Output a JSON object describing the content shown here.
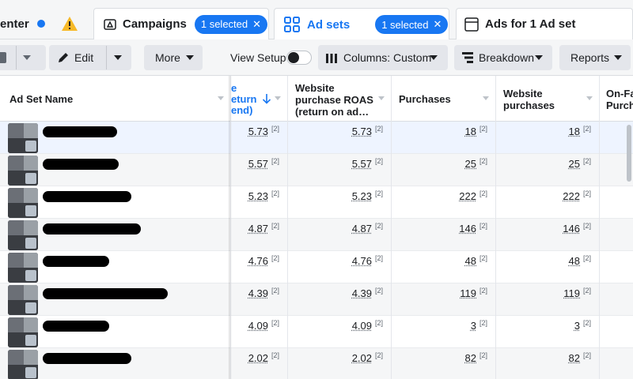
{
  "tabs": {
    "first_label": "enter",
    "campaigns_label": "Campaigns",
    "campaigns_selected": "1 selected",
    "adsets_label": "Ad sets",
    "adsets_selected": "1 selected",
    "ads_label": "Ads for 1 Ad set",
    "close_glyph": "✕"
  },
  "toolbar": {
    "edit_label": "Edit",
    "more_label": "More",
    "view_setup_label": "View Setup",
    "columns_label": "Columns: Custom",
    "breakdown_label": "Breakdown",
    "reports_label": "Reports"
  },
  "table": {
    "headers": {
      "name": "Ad Set Name",
      "roas_partial_1": "e",
      "roas_partial_2": "eturn",
      "roas_partial_3": "end)",
      "website_roas": "Website purchase ROAS (return on ad…",
      "purchases": "Purchases",
      "website_purchases": "Website purchases",
      "onfacebook": "On-Fa Purcha"
    },
    "footnote": "[2]",
    "rows": [
      {
        "roas": "5.73",
        "website_roas": "5.73",
        "purchases": "18",
        "website_purchases": "18"
      },
      {
        "roas": "5.57",
        "website_roas": "5.57",
        "purchases": "25",
        "website_purchases": "25"
      },
      {
        "roas": "5.23",
        "website_roas": "5.23",
        "purchases": "222",
        "website_purchases": "222"
      },
      {
        "roas": "4.87",
        "website_roas": "4.87",
        "purchases": "146",
        "website_purchases": "146"
      },
      {
        "roas": "4.76",
        "website_roas": "4.76",
        "purchases": "48",
        "website_purchases": "48"
      },
      {
        "roas": "4.39",
        "website_roas": "4.39",
        "purchases": "119",
        "website_purchases": "119"
      },
      {
        "roas": "4.09",
        "website_roas": "4.09",
        "purchases": "3",
        "website_purchases": "3"
      },
      {
        "roas": "2.02",
        "website_roas": "2.02",
        "purchases": "82",
        "website_purchases": "82"
      }
    ]
  },
  "colors": {
    "accent": "#1877f2",
    "warning": "#f7b928"
  },
  "icons": {
    "warning": "warning-icon",
    "campaigns": "campaigns-icon",
    "adsets": "adsets-grid-icon",
    "ads": "ad-icon"
  }
}
